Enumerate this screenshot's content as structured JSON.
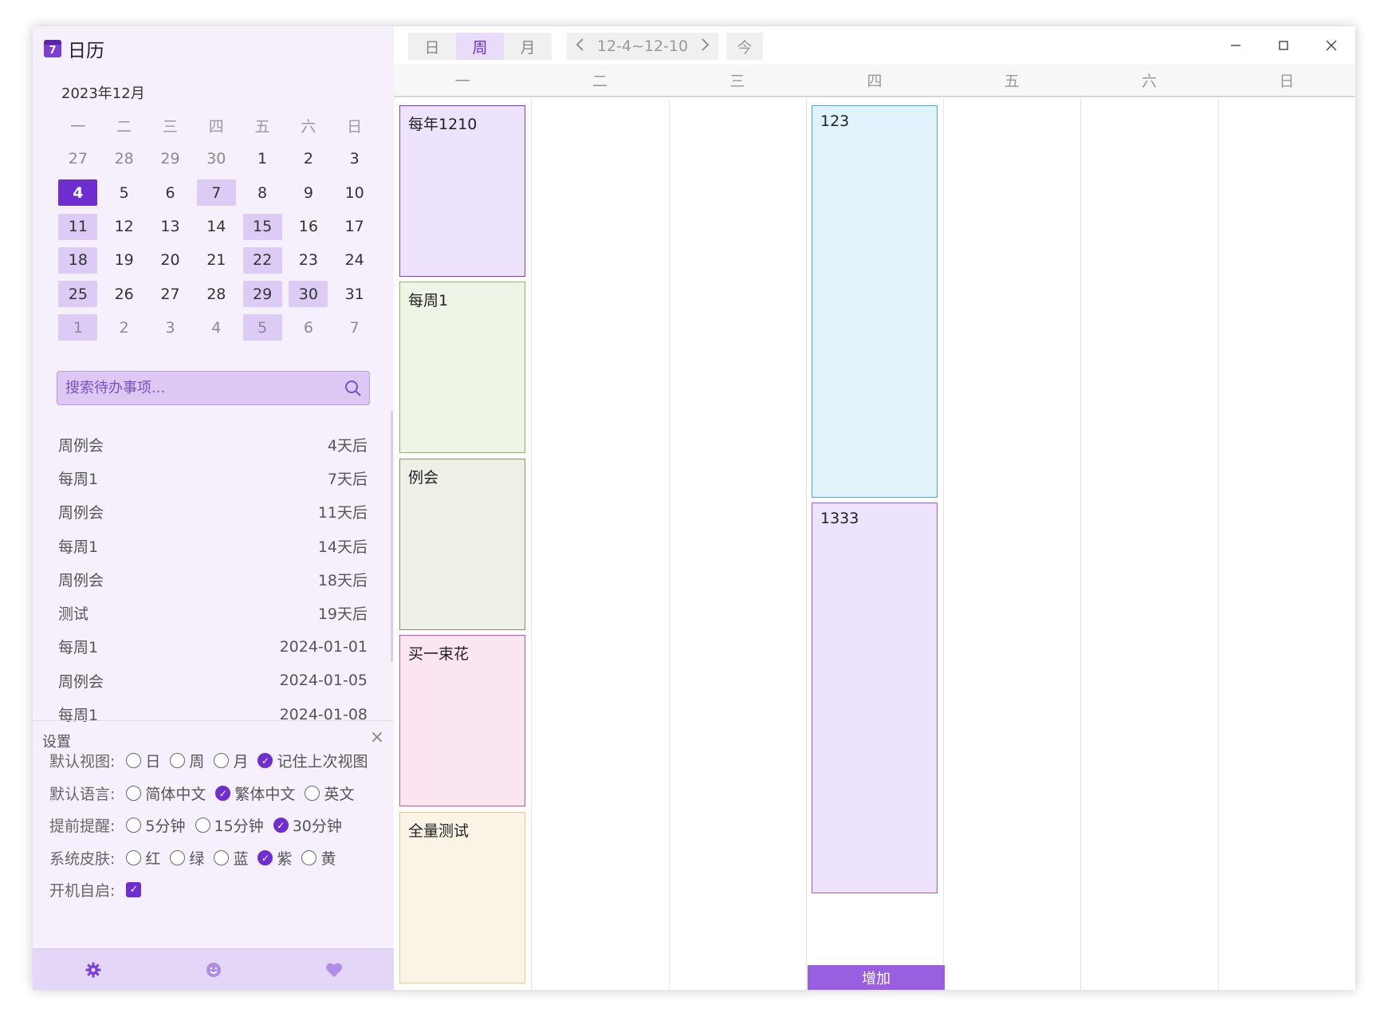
{
  "app": {
    "title": "日历",
    "icon": "calendar-icon"
  },
  "mini_calendar": {
    "month_label": "2023年12月",
    "weekdays": [
      "一",
      "二",
      "三",
      "四",
      "五",
      "六",
      "日"
    ],
    "days": [
      {
        "n": "27",
        "other": true
      },
      {
        "n": "28",
        "other": true
      },
      {
        "n": "29",
        "other": true
      },
      {
        "n": "30",
        "other": true
      },
      {
        "n": "1"
      },
      {
        "n": "2"
      },
      {
        "n": "3"
      },
      {
        "n": "4",
        "today": true
      },
      {
        "n": "5"
      },
      {
        "n": "6"
      },
      {
        "n": "7",
        "event": true
      },
      {
        "n": "8"
      },
      {
        "n": "9"
      },
      {
        "n": "10"
      },
      {
        "n": "11",
        "event": true
      },
      {
        "n": "12"
      },
      {
        "n": "13"
      },
      {
        "n": "14"
      },
      {
        "n": "15",
        "event": true
      },
      {
        "n": "16"
      },
      {
        "n": "17"
      },
      {
        "n": "18",
        "event": true
      },
      {
        "n": "19"
      },
      {
        "n": "20"
      },
      {
        "n": "21"
      },
      {
        "n": "22",
        "event": true
      },
      {
        "n": "23"
      },
      {
        "n": "24"
      },
      {
        "n": "25",
        "event": true
      },
      {
        "n": "26"
      },
      {
        "n": "27"
      },
      {
        "n": "28"
      },
      {
        "n": "29",
        "event": true
      },
      {
        "n": "30",
        "event": true
      },
      {
        "n": "31"
      },
      {
        "n": "1",
        "other": true,
        "event": true
      },
      {
        "n": "2",
        "other": true
      },
      {
        "n": "3",
        "other": true
      },
      {
        "n": "4",
        "other": true
      },
      {
        "n": "5",
        "other": true,
        "event": true
      },
      {
        "n": "6",
        "other": true
      },
      {
        "n": "7",
        "other": true
      }
    ]
  },
  "search": {
    "placeholder": "搜索待办事项..."
  },
  "todos": [
    {
      "title": "周例会",
      "when": "4天后"
    },
    {
      "title": "每周1",
      "when": "7天后"
    },
    {
      "title": "周例会",
      "when": "11天后"
    },
    {
      "title": "每周1",
      "when": "14天后"
    },
    {
      "title": "周例会",
      "when": "18天后"
    },
    {
      "title": "测试",
      "when": "19天后"
    },
    {
      "title": "每周1",
      "when": "2024-01-01"
    },
    {
      "title": "周例会",
      "when": "2024-01-05"
    },
    {
      "title": "每周1",
      "when": "2024-01-08"
    }
  ],
  "settings": {
    "title": "设置",
    "close": "×",
    "rows": [
      {
        "label": "默认视图:",
        "options": [
          "日",
          "周",
          "月",
          "记住上次视图"
        ],
        "selected": 3
      },
      {
        "label": "默认语言:",
        "options": [
          "简体中文",
          "繁体中文",
          "英文"
        ],
        "selected": 1
      },
      {
        "label": "提前提醒:",
        "options": [
          "5分钟",
          "15分钟",
          "30分钟"
        ],
        "selected": 2
      },
      {
        "label": "系统皮肤:",
        "options": [
          "红",
          "绿",
          "蓝",
          "紫",
          "黄"
        ],
        "selected": 3
      }
    ],
    "autostart": {
      "label": "开机自启:",
      "checked": true
    }
  },
  "footer_icons": [
    "gear-icon",
    "smile-icon",
    "heart-icon"
  ],
  "toolbar": {
    "views": [
      "日",
      "周",
      "月"
    ],
    "active_view": 1,
    "range": "12-4~12-10",
    "today": "今"
  },
  "week_days": [
    "一",
    "二",
    "三",
    "四",
    "五",
    "六",
    "日"
  ],
  "events": [
    {
      "title": "每年1210",
      "day": 0,
      "slot": 0,
      "color": "#7a3fd6",
      "bg": "#ede3fc"
    },
    {
      "title": "每周1",
      "day": 0,
      "slot": 1,
      "color": "#88b85a",
      "bg": "#eff5e6"
    },
    {
      "title": "例会",
      "day": 0,
      "slot": 2,
      "color": "#8a9060",
      "bg": "#eeefe7"
    },
    {
      "title": "买一束花",
      "day": 0,
      "slot": 3,
      "color": "#c8559a",
      "bg": "#fbe5f1"
    },
    {
      "title": "全量测试",
      "day": 0,
      "slot": 4,
      "color": "#e2c98d",
      "bg": "#faf3e6"
    },
    {
      "title": "123",
      "day": 3,
      "slot": 0,
      "color": "#4aaad4",
      "bg": "#e1f3fa"
    },
    {
      "title": "1333",
      "day": 3,
      "slot": 1,
      "color": "#9c5fd9",
      "bg": "#ede3fc"
    }
  ],
  "add_label": "增加",
  "window_controls": [
    "minimize-icon",
    "maximize-icon",
    "close-icon"
  ]
}
